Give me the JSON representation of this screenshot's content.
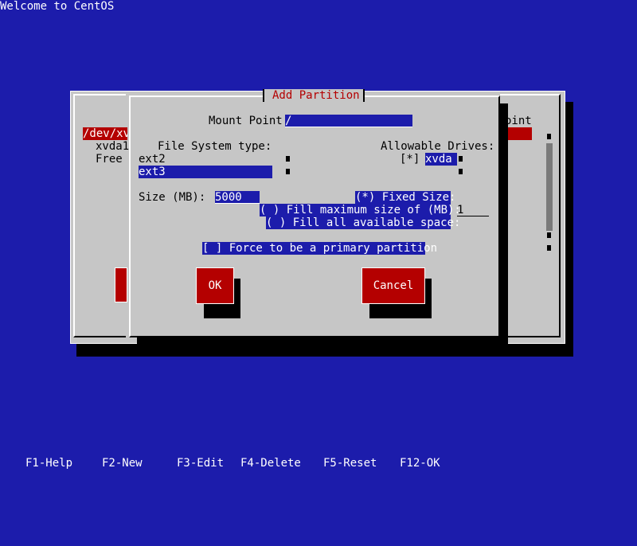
{
  "window_title": "Welcome to CentOS",
  "background_dialog": {
    "device_item": "/dev/xv",
    "partition_item": "xvda1",
    "free_item": "Free",
    "column_header_fragment": "oint"
  },
  "add_partition": {
    "title": "Add Partition",
    "mount_point_label": "Mount Point:",
    "mount_point_value": "/",
    "fs_type_label": "File System type:",
    "fs_types": [
      "ext2",
      "ext3"
    ],
    "fs_selected": "ext3",
    "allowable_drives_label": "Allowable Drives:",
    "drive_checkbox": "[*]",
    "drive_name": "xvda",
    "size_label": "Size (MB):",
    "size_value": "5000",
    "size_options": {
      "fixed": "(*) Fixed Size:",
      "fill_max": "( ) Fill maximum size of (MB):",
      "fill_max_value": "1",
      "fill_all": "( ) Fill all available space:"
    },
    "primary_partition": "[ ] Force to be a primary partition",
    "ok_label": "OK",
    "cancel_label": "Cancel"
  },
  "footer": [
    {
      "key": "F1-Help"
    },
    {
      "key": "F2-New"
    },
    {
      "key": "F3-Edit"
    },
    {
      "key": "F4-Delete"
    },
    {
      "key": "F5-Reset"
    },
    {
      "key": "F12-OK"
    }
  ],
  "colors": {
    "background": "#1c1cab",
    "dialog": "#c6c6c6",
    "accent_red": "#b40000"
  }
}
